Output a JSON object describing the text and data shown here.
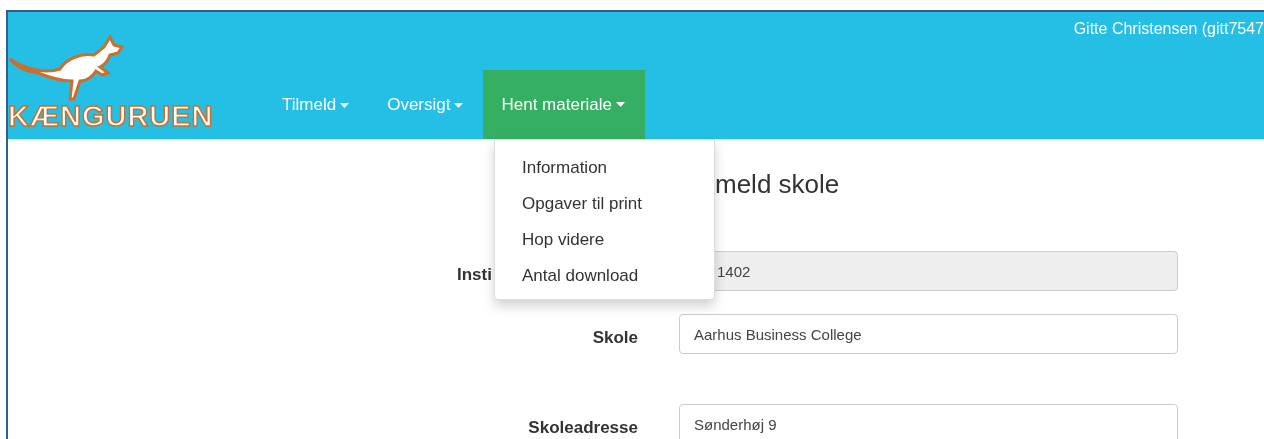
{
  "header": {
    "logo_text": "KÆNGURUEN",
    "user": "Gitte Christensen (gitt7547"
  },
  "nav": [
    {
      "label": "Tilmeld",
      "selected": false
    },
    {
      "label": "Oversigt",
      "selected": false
    },
    {
      "label": "Hent materiale",
      "selected": true
    }
  ],
  "dropdown": {
    "items": [
      "Information",
      "Opgaver til print",
      "Hop videre",
      "Antal download"
    ]
  },
  "form": {
    "title": "meld skole",
    "fields": [
      {
        "kind": "readonly",
        "label": "Insti",
        "value": "1402"
      },
      {
        "kind": "text",
        "label": "Skole",
        "value": "Aarhus Business College"
      },
      {
        "kind": "text",
        "label": "Skoleadresse",
        "value": "Sønderhøj 9"
      }
    ]
  }
}
